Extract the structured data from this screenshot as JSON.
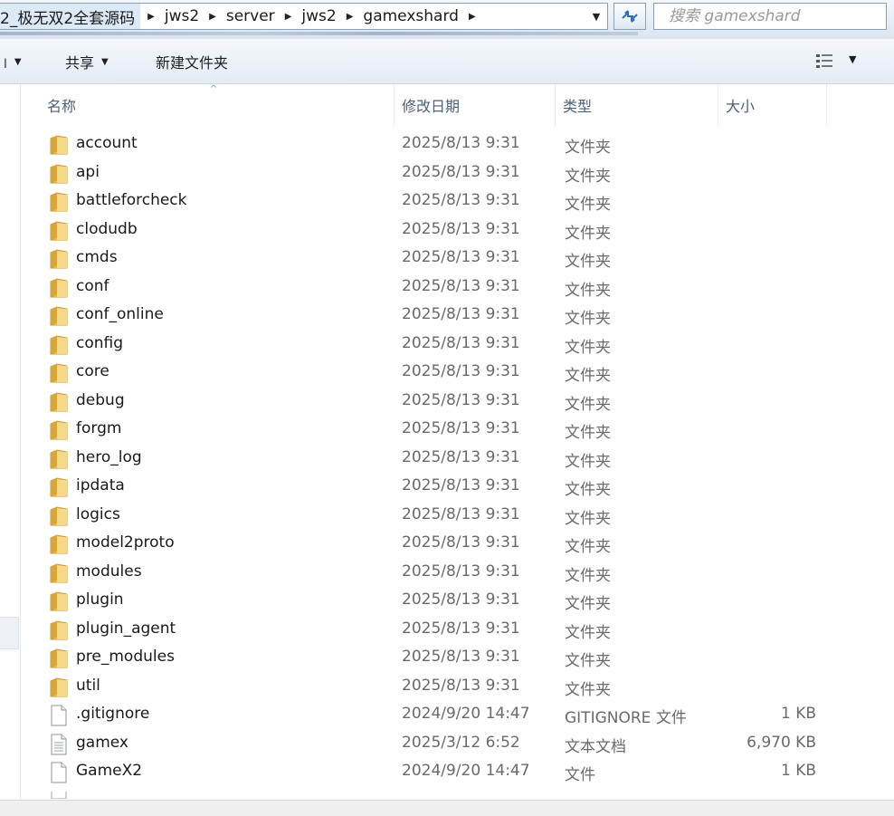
{
  "address_bar": {
    "crumbs": [
      "2_极无双2全套源码",
      "jws2",
      "server",
      "jws2",
      "gamexshard"
    ],
    "separator": "▶",
    "dropdown_icon": "chevron-down-icon",
    "refresh_icon": "refresh-icon"
  },
  "search": {
    "placeholder": "搜索 gamexshard"
  },
  "toolbar": {
    "first_caret": "▼",
    "share_label": "共享",
    "share_caret": "▼",
    "new_folder_label": "新建文件夹",
    "view_caret": "▼"
  },
  "columns": {
    "name": "名称",
    "modified": "修改日期",
    "type": "类型",
    "size": "大小",
    "sort_indicator": "^"
  },
  "files": [
    {
      "name": "account",
      "date": "2025/8/13 9:31",
      "type": "文件夹",
      "size": "",
      "kind": "folder"
    },
    {
      "name": "api",
      "date": "2025/8/13 9:31",
      "type": "文件夹",
      "size": "",
      "kind": "folder"
    },
    {
      "name": "battleforcheck",
      "date": "2025/8/13 9:31",
      "type": "文件夹",
      "size": "",
      "kind": "folder"
    },
    {
      "name": "clodudb",
      "date": "2025/8/13 9:31",
      "type": "文件夹",
      "size": "",
      "kind": "folder"
    },
    {
      "name": "cmds",
      "date": "2025/8/13 9:31",
      "type": "文件夹",
      "size": "",
      "kind": "folder"
    },
    {
      "name": "conf",
      "date": "2025/8/13 9:31",
      "type": "文件夹",
      "size": "",
      "kind": "folder"
    },
    {
      "name": "conf_online",
      "date": "2025/8/13 9:31",
      "type": "文件夹",
      "size": "",
      "kind": "folder"
    },
    {
      "name": "config",
      "date": "2025/8/13 9:31",
      "type": "文件夹",
      "size": "",
      "kind": "folder"
    },
    {
      "name": "core",
      "date": "2025/8/13 9:31",
      "type": "文件夹",
      "size": "",
      "kind": "folder"
    },
    {
      "name": "debug",
      "date": "2025/8/13 9:31",
      "type": "文件夹",
      "size": "",
      "kind": "folder"
    },
    {
      "name": "forgm",
      "date": "2025/8/13 9:31",
      "type": "文件夹",
      "size": "",
      "kind": "folder"
    },
    {
      "name": "hero_log",
      "date": "2025/8/13 9:31",
      "type": "文件夹",
      "size": "",
      "kind": "folder"
    },
    {
      "name": "ipdata",
      "date": "2025/8/13 9:31",
      "type": "文件夹",
      "size": "",
      "kind": "folder"
    },
    {
      "name": "logics",
      "date": "2025/8/13 9:31",
      "type": "文件夹",
      "size": "",
      "kind": "folder"
    },
    {
      "name": "model2proto",
      "date": "2025/8/13 9:31",
      "type": "文件夹",
      "size": "",
      "kind": "folder"
    },
    {
      "name": "modules",
      "date": "2025/8/13 9:31",
      "type": "文件夹",
      "size": "",
      "kind": "folder"
    },
    {
      "name": "plugin",
      "date": "2025/8/13 9:31",
      "type": "文件夹",
      "size": "",
      "kind": "folder"
    },
    {
      "name": "plugin_agent",
      "date": "2025/8/13 9:31",
      "type": "文件夹",
      "size": "",
      "kind": "folder"
    },
    {
      "name": "pre_modules",
      "date": "2025/8/13 9:31",
      "type": "文件夹",
      "size": "",
      "kind": "folder"
    },
    {
      "name": "util",
      "date": "2025/8/13 9:31",
      "type": "文件夹",
      "size": "",
      "kind": "folder"
    },
    {
      "name": ".gitignore",
      "date": "2024/9/20 14:47",
      "type": "GITIGNORE 文件",
      "size": "1 KB",
      "kind": "file"
    },
    {
      "name": "gamex",
      "date": "2025/3/12 6:52",
      "type": "文本文档",
      "size": "6,970 KB",
      "kind": "text"
    },
    {
      "name": "GameX2",
      "date": "2024/9/20 14:47",
      "type": "文件",
      "size": "1 KB",
      "kind": "file"
    }
  ],
  "colors": {
    "folder": "#e8b84a",
    "accent": "#2a6fc0",
    "header_text": "#4c607a",
    "meta_text": "#6a6a6a"
  }
}
